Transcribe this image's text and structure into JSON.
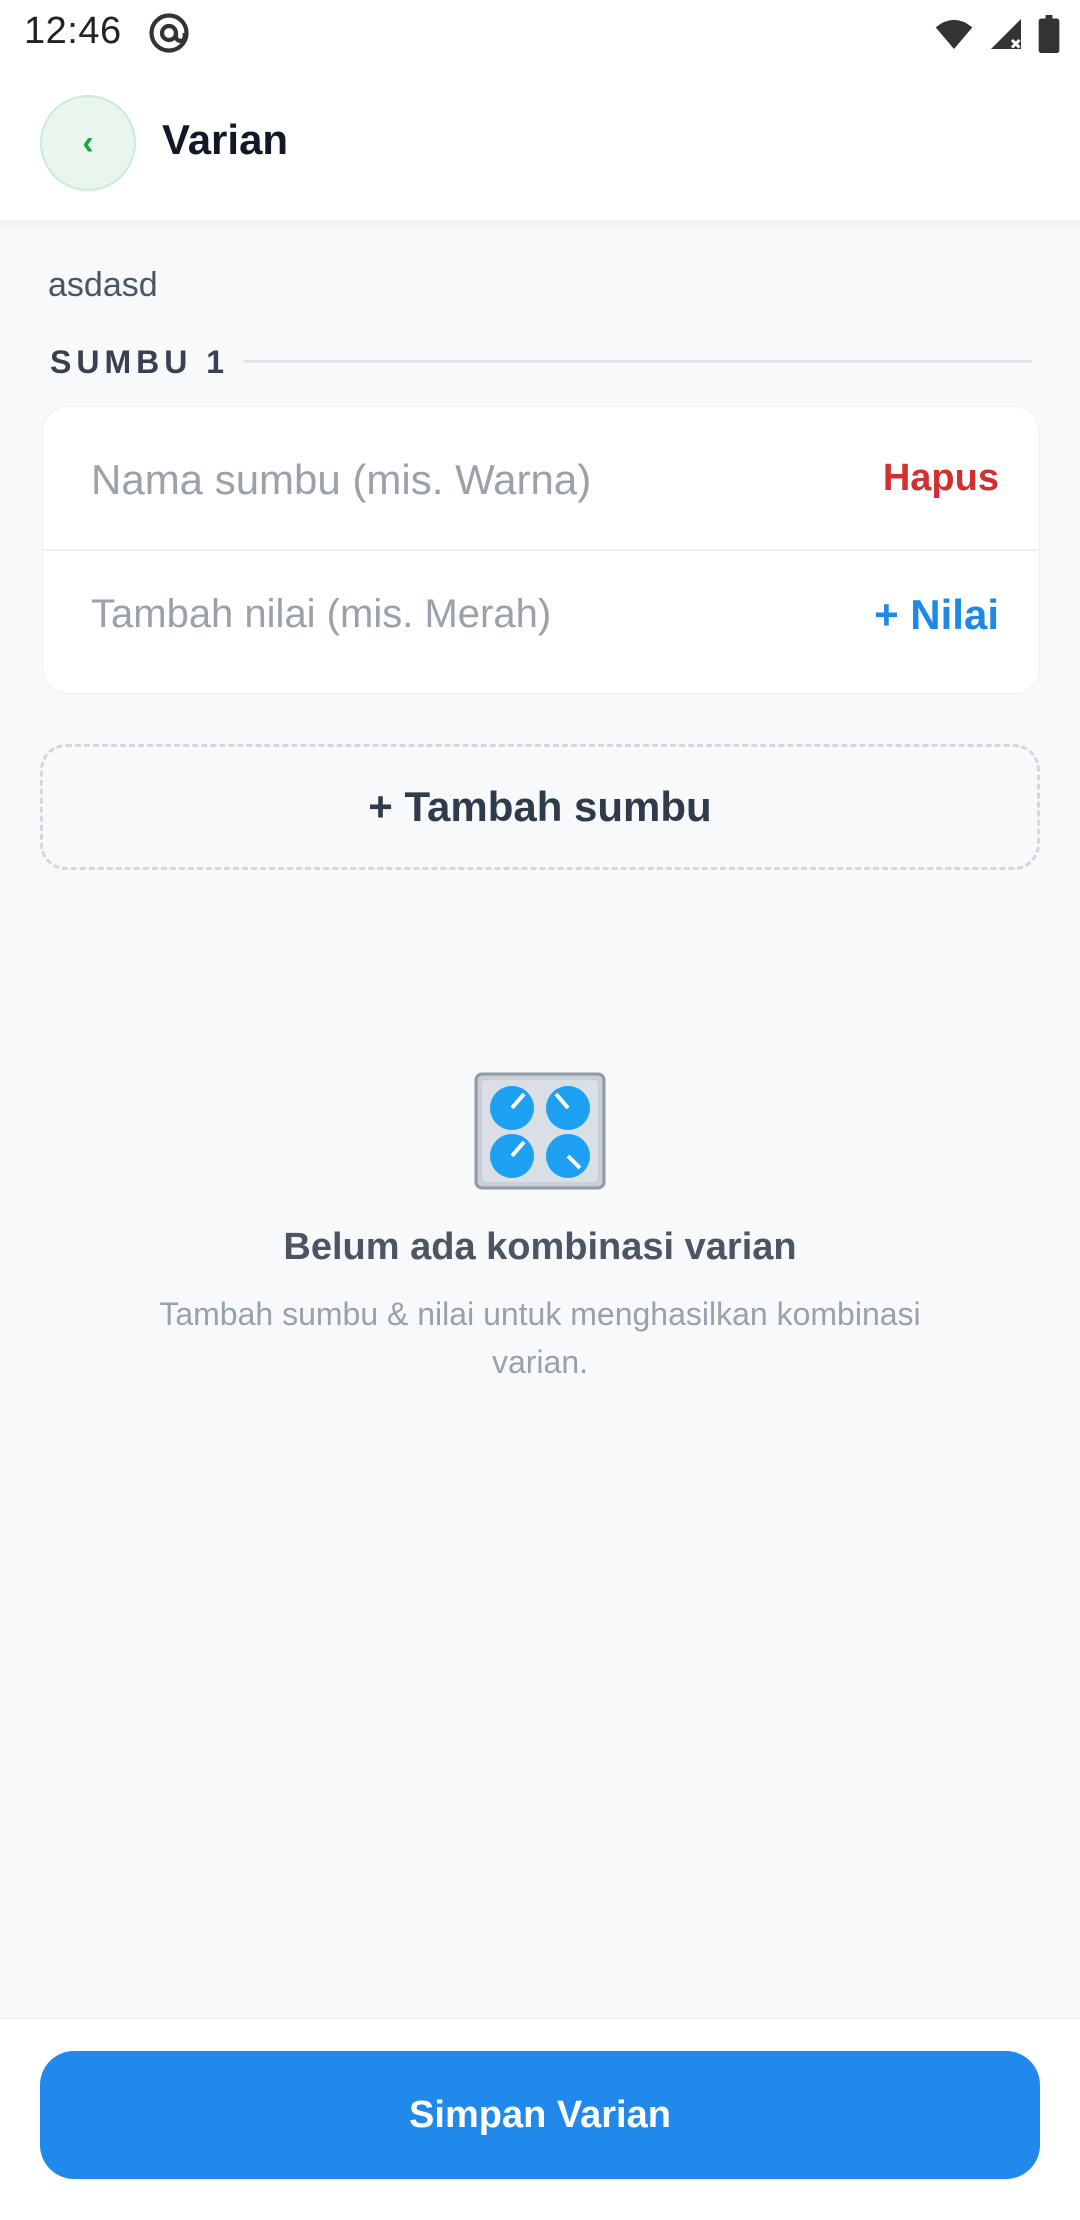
{
  "status_bar": {
    "time": "12:46",
    "icons": [
      "at-sign-icon",
      "wifi-icon",
      "signal-icon",
      "battery-icon"
    ]
  },
  "header": {
    "back_icon": "‹",
    "title": "Varian"
  },
  "product": {
    "name": "asdasd"
  },
  "axis": {
    "section_label": "SUMBU 1",
    "name_placeholder": "Nama sumbu (mis. Warna)",
    "delete_label": "Hapus",
    "value_placeholder": "Tambah nilai (mis. Merah)",
    "add_value_label": "+ Nilai"
  },
  "add_axis_label": "+ Tambah sumbu",
  "empty_state": {
    "icon": "control-knobs-icon",
    "title": "Belum ada kombinasi varian",
    "description": "Tambah sumbu & nilai untuk menghasilkan kombinasi varian."
  },
  "footer": {
    "save_label": "Simpan Varian"
  },
  "colors": {
    "accent": "#2188ec",
    "danger": "#d32f2f",
    "link": "#1e88e5",
    "back_button_bg": "#e8f6ee"
  }
}
